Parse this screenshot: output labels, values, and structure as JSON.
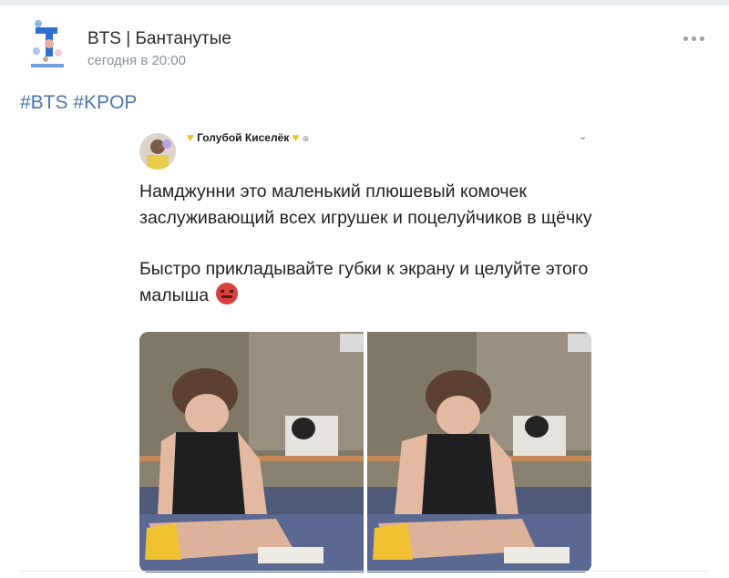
{
  "post": {
    "group_name": "BTS | Бантанутые",
    "time": "сегодня в 20:00",
    "hashtags": [
      "#BTS",
      "#KPOP"
    ]
  },
  "tweet": {
    "author": "Голубой Киселёк",
    "paragraph1": "Намджунни это маленький плюшевый комочек заслуживающий всех игрушек и поцелуйчиков в щёчку",
    "paragraph2": "Быстро прикладывайте губки к экрану и целуйте этого малыша"
  },
  "icons": {
    "more": "more-horizontal-icon",
    "heart": "yellow-heart-icon",
    "angry": "angry-face-emoji-icon",
    "chevron": "chevron-down-icon"
  },
  "colors": {
    "link": "#4a76a8",
    "meta": "#8a939c",
    "text": "#2a2a2a"
  }
}
